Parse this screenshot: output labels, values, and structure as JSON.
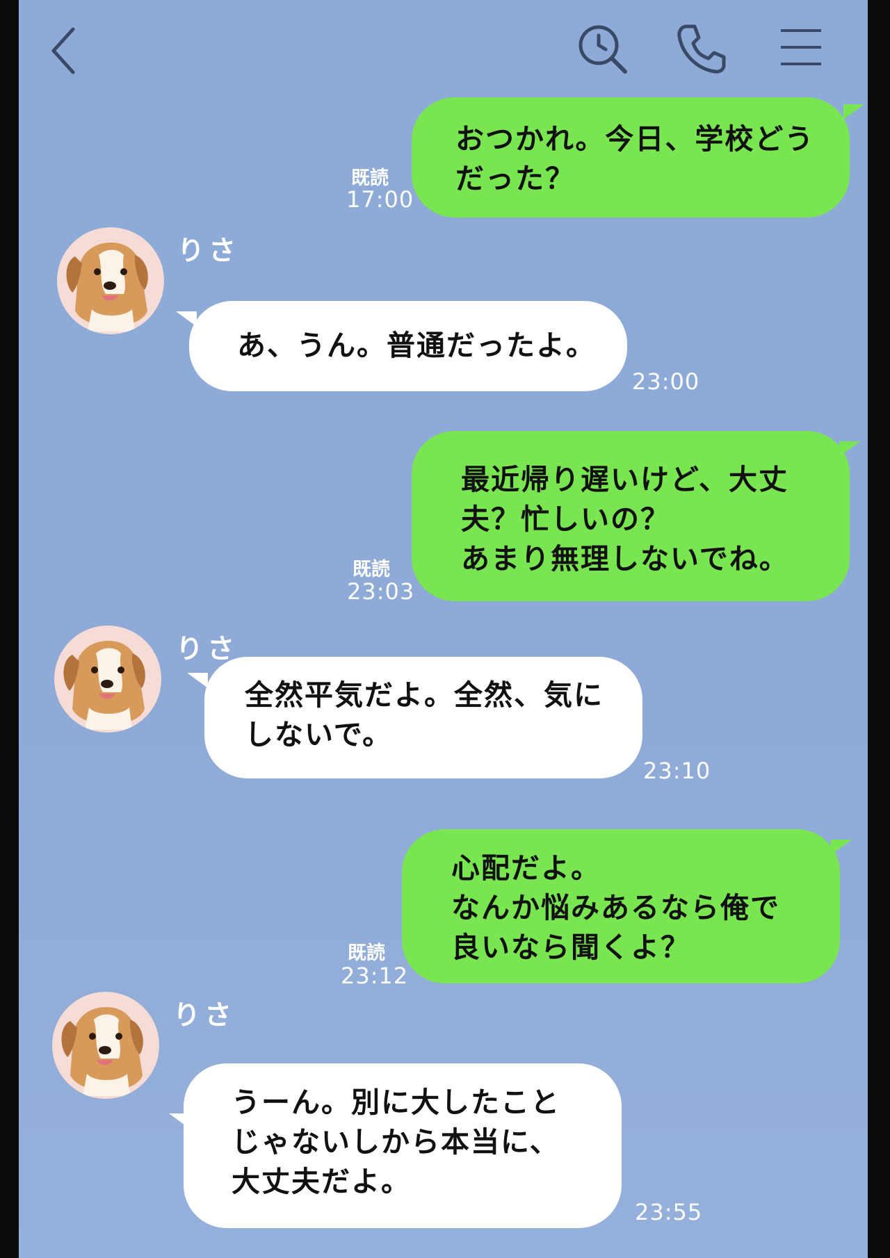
{
  "header": {
    "back_icon": "chevron-left-icon",
    "search_icon": "search-history-icon",
    "call_icon": "phone-icon",
    "menu_icon": "hamburger-menu-icon"
  },
  "colors": {
    "background": "#8eaad6",
    "my_bubble": "#79e551",
    "their_bubble": "#ffffff"
  },
  "messages": [
    {
      "sender": "me",
      "text": "おつかれ。今日、学校どう\nだった？",
      "read": "既読",
      "time": "17:00"
    },
    {
      "sender": "them",
      "name": "りさ",
      "text": "あ、うん。普通だったよ。",
      "time": "23:00"
    },
    {
      "sender": "me",
      "text": "最近帰り遅いけど、大丈\n夫？忙しいの？\nあまり無理しないでね。",
      "read": "既読",
      "time": "23:03"
    },
    {
      "sender": "them",
      "name": "りさ",
      "text": "全然平気だよ。全然、気に\nしないで。",
      "time": "23:10"
    },
    {
      "sender": "me",
      "text": "心配だよ。\nなんか悩みあるなら俺で\n良いなら聞くよ？",
      "read": "既読",
      "time": "23:12"
    },
    {
      "sender": "them",
      "name": "りさ",
      "text": "うーん。別に大したこと\nじゃないしから本当に、\n大丈夫だよ。",
      "time": "23:55"
    }
  ]
}
